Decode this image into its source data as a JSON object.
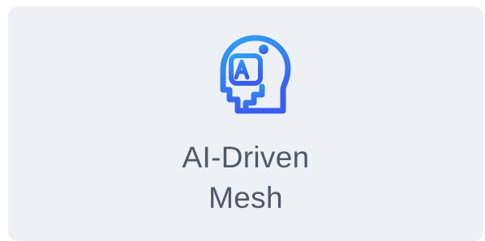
{
  "card": {
    "icon": "ai-head-icon",
    "title_line1": "AI-Driven",
    "title_line2": "Mesh",
    "background": "#edf0f5",
    "text_color": "#4f5968",
    "icon_gradient": [
      "#2f9cf2",
      "#3b5ff0"
    ]
  }
}
